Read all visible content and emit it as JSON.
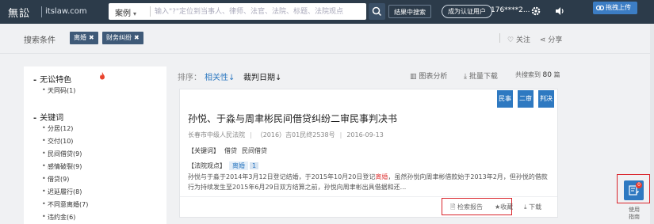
{
  "topbar": {
    "logo": "無訟",
    "site": "itslaw.com",
    "search_category": "案例",
    "search_placeholder": "输入\"?\"定位到当事人、律师、法官、法院、标题、法院观点",
    "result_search_label": "结果中搜索",
    "certify_label": "成为认证用户",
    "phone": "176****2...",
    "install_label": "拖拽上传"
  },
  "filters": {
    "label": "搜索条件",
    "tags": [
      "离婚",
      "财务纠纷"
    ],
    "follow": "关注",
    "share": "分享"
  },
  "left": {
    "sections": [
      {
        "title": "无讼特色",
        "items": [
          "天同码(1)"
        ]
      },
      {
        "title": "关键词",
        "items": [
          "分居(12)",
          "交付(10)",
          "民间借贷(9)",
          "感情破裂(9)",
          "借贷(9)",
          "迟延履行(8)",
          "不同意离婚(7)",
          "违约金(6)"
        ]
      }
    ]
  },
  "sortbar": {
    "label": "排序：",
    "relevance": "相关性",
    "date": "裁判日期",
    "chart": "图表分析",
    "batch": "批量下载",
    "total_prefix": "共搜索到",
    "total_count": "80",
    "total_suffix": "篇"
  },
  "card": {
    "badges": [
      "民事",
      "二审",
      "判决"
    ],
    "title": "孙悦、于淼与周聿彬民间借贷纠纷二审民事判决书",
    "court": "长春市中级人民法院",
    "case_no": "（2016）吉01民终2538号",
    "date": "2016-09-13",
    "keyword_label": "【关键词】",
    "keywords": [
      "借贷",
      "民间借贷"
    ],
    "view_label": "【法院观点】",
    "view_tag": "离婚",
    "view_num": "1",
    "excerpt_pre": "孙悦与于淼于2014年3月12日登记结婚，于2015年10月20日登记",
    "excerpt_hl": "离婚",
    "excerpt_post": "，虽然孙悦向周聿彬借款始于2013年2月，但孙悦的借款行为持续发生至2015年6月29日双方结算之前，孙悦向周聿彬出具借据和还...",
    "report": "检索报告",
    "collect": "收藏",
    "download": "下载"
  },
  "widget": {
    "badge": "0",
    "guide_line1": "使用",
    "guide_line2": "指南"
  }
}
